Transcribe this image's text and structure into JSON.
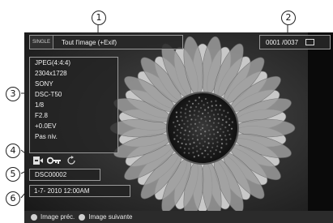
{
  "callouts": [
    "1",
    "2",
    "3",
    "4",
    "5",
    "6"
  ],
  "top": {
    "single_tag": "SINGLE",
    "mode": "Tout l'image (+Exif)",
    "counter": "0001 /0037",
    "counter_icon": "display-icon"
  },
  "info": {
    "lines": [
      "JPEG(4:4:4)",
      "2304x1728",
      "SONY",
      "DSC-T50",
      "1/8",
      "F2.8",
      "+0.0EV",
      "Pas niv."
    ]
  },
  "icons": {
    "import": "import-icon",
    "protect": "key-icon",
    "rotate": "rotate-icon"
  },
  "file": {
    "name": "DSC00002"
  },
  "datetime": {
    "value": "1-7- 2010 12:00AM"
  },
  "nav": {
    "prev_label": "Image préc.",
    "next_label": "Image suivante"
  }
}
